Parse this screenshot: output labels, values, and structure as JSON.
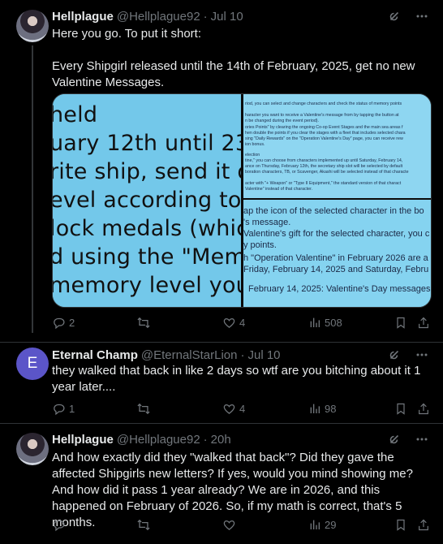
{
  "tweets": [
    {
      "name": "Hellplague",
      "handle": "@Hellplague92",
      "time": "Jul 10",
      "text": "Here you go. To put it short:\n\nEvery Shipgirl released until the 14th of February, 2025, get no new Valentine Messages.",
      "media": {
        "left_lines": [
          "held",
          "uary 12th until 23",
          "rite ship, send it o",
          "evel according to",
          "lock medals (whic",
          "d using the \"Memo",
          "memory level you"
        ],
        "top_right_lines": [
          "riod, you can select and change characters and check the status of memory points",
          "",
          "haracter you want to receive a Valentine's message from by tapping the button at",
          "n be changed during the event period).",
          "ories Points\" by clearing the ongoing Co-op Event Stages and the main sea areas f",
          "hen double the points if you clear the stages with a fleet that includes selected chara",
          "sing \"Daily Rewards\" on the \"Operation Valentine's Day\" page, you can receive rew",
          "ion bonus.",
          "",
          "election",
          "tine,\" you can choose from characters implemented up until Saturday, February 14,",
          "ance on Thursday, February 12th, the secretary ship slot will be selected by default",
          "boration characters, TB, or Scavenger, Akashi will be selected instead of that characte",
          "",
          "acter with \"+ Weapon\" or \"Type II Equipment,\" the standard version of that charact",
          "Valentine\" instead of that character."
        ],
        "bottom_right_lines": [
          "ap the icon of the selected character in the bo",
          "'s message.",
          "Valentine's gift for the selected character, you c",
          "y points.",
          "h \"Operation Valentine\" in February 2026 are a",
          "Friday, February 14, 2025 and Saturday, Febru",
          "",
          "February 14, 2025: Valentine's Day messages"
        ]
      },
      "replies": "2",
      "retweets": "",
      "likes": "4",
      "views": "508"
    },
    {
      "name": "Eternal Champ",
      "handle": "@EternalStarLion",
      "time": "Jul 10",
      "avatar_letter": "E",
      "text": "they walked that back in like 2 days so wtf are you bitching about it 1 year later....",
      "replies": "1",
      "retweets": "",
      "likes": "4",
      "views": "98"
    },
    {
      "name": "Hellplague",
      "handle": "@Hellplague92",
      "time": "20h",
      "text": "And how exactly did they \"walked that back\"? Did they gave the affected Shipgirls new letters? If yes, would you mind showing me? And how did it pass 1 year already? We are in 2026, and this happened on February of 2026. So, if my math is correct, that's 5 months.",
      "replies": "",
      "retweets": "",
      "likes": "",
      "views": "29"
    }
  ],
  "icons": {
    "grok": "grok-icon",
    "more": "more-icon",
    "reply": "reply-icon",
    "retweet": "retweet-icon",
    "like": "like-icon",
    "views": "views-icon",
    "bookmark": "bookmark-icon",
    "share": "share-icon"
  },
  "colors": {
    "background": "#000000",
    "text": "#e7e9ea",
    "secondary": "#71767b",
    "border": "#2f3336",
    "avatar_letter_bg": "#5b55c8"
  }
}
